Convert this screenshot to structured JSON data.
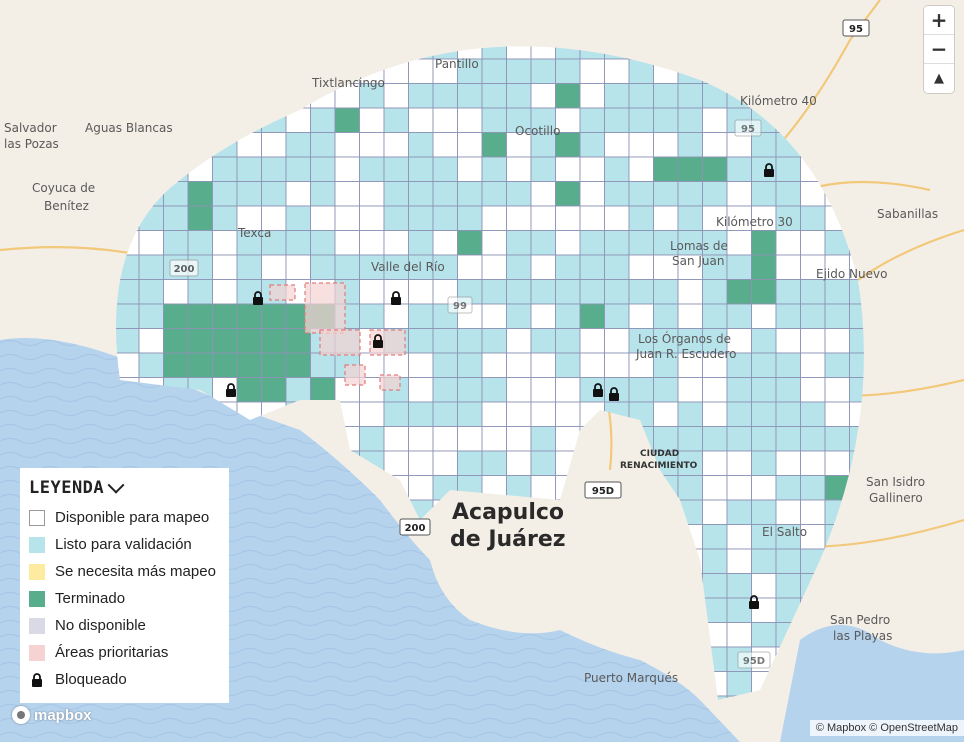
{
  "map": {
    "places": [
      {
        "name": "Pantillo"
      },
      {
        "name": "Tixtlancingo"
      },
      {
        "name": "Kilómetro 40"
      },
      {
        "name": "Salvador"
      },
      {
        "name": "las Pozas"
      },
      {
        "name": "Aguas Blancas"
      },
      {
        "name": "Ocotillo"
      },
      {
        "name": "Coyuca de"
      },
      {
        "name": "Benítez"
      },
      {
        "name": "Sabanillas"
      },
      {
        "name": "Kilómetro 30"
      },
      {
        "name": "Texca"
      },
      {
        "name": "Lomas de"
      },
      {
        "name": "San Juan"
      },
      {
        "name": "Valle del Río"
      },
      {
        "name": "Ejido Nuevo"
      },
      {
        "name": "Los Órganos de"
      },
      {
        "name": "Juan R. Escudero"
      },
      {
        "name": "San Isidro"
      },
      {
        "name": "Gallinero"
      },
      {
        "name": "El Salto"
      },
      {
        "name": "San Pedro"
      },
      {
        "name": "las Playas"
      },
      {
        "name": "Puerto Marqués"
      }
    ],
    "city_line1": "Acapulco",
    "city_line2": "de Juárez",
    "ciudad_line1": "CIUDAD",
    "ciudad_line2": "RENACIMIENTO",
    "shields": [
      {
        "label": "95"
      },
      {
        "label": "95"
      },
      {
        "label": "200"
      },
      {
        "label": "99"
      },
      {
        "label": "95D"
      },
      {
        "label": "200"
      },
      {
        "label": "95D"
      }
    ]
  },
  "colors": {
    "available": "#ffffff",
    "ready_validation": "#b6e4ea",
    "needs_mapping": "#fdeba0",
    "finished": "#58ad8d",
    "unavailable": "#d9dae6",
    "priority": "#f5d3d3",
    "grid_line": "#8d93b5",
    "water": "#b6d3ee",
    "land": "#f4efe6"
  },
  "zoom": {
    "in_label": "+",
    "out_label": "−",
    "compass_label": "▲"
  },
  "legend": {
    "title": "LEYENDA",
    "items": [
      {
        "label": "Disponible para mapeo"
      },
      {
        "label": "Listo para validación"
      },
      {
        "label": "Se necesita más mapeo"
      },
      {
        "label": "Terminado"
      },
      {
        "label": "No disponible"
      },
      {
        "label": "Áreas prioritarias"
      },
      {
        "label": "Bloqueado"
      }
    ]
  },
  "footer": {
    "mapbox_label": "mapbox",
    "attribution": "© Mapbox © OpenStreetMap"
  }
}
